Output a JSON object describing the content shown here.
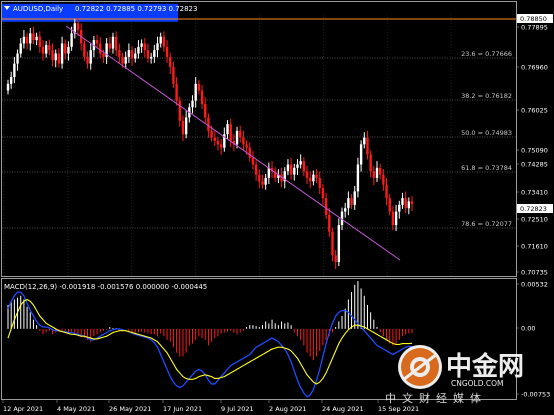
{
  "header": {
    "symbol": "AUDUSD,Daily",
    "ohlc": "0.72822 0.72885 0.72793 0.72823"
  },
  "macd": {
    "header": "MACD(12,26,9) -0.001918 -0.001576 0.000000 -0.000445"
  },
  "chart_data": [
    {
      "type": "candlestick",
      "title": "AUDUSD,Daily",
      "y_ticks": [
        "0.77895",
        "0.76960",
        "0.76025",
        "0.75090",
        "0.74285",
        "0.73410",
        "0.72510",
        "0.71610",
        "0.70735"
      ],
      "ylim": [
        0.7068,
        0.78
      ],
      "x_ticks": [
        "12 Apr 2021",
        "4 May 2021",
        "26 May 2021",
        "17 Jun 2021",
        "9 Jul 2021",
        "2 Aug 2021",
        "24 Aug 2021",
        "15 Sep 2021"
      ],
      "price_labels": {
        "high_line": "0.78850",
        "current": "0.72823"
      },
      "fibonacci": [
        {
          "label": "23.6 = 0.77666",
          "value": 0.77666
        },
        {
          "label": "38.2 = 0.76182",
          "value": 0.76182
        },
        {
          "label": "50.0 = 0.74983",
          "value": 0.74983
        },
        {
          "label": "61.8 = 0.73784",
          "value": 0.73784
        },
        {
          "label": "78.6 = 0.72077",
          "value": 0.72077
        }
      ],
      "high_level": 0.7785,
      "highlight_zone": [
        0.7768,
        0.7795
      ],
      "trendline": [
        [
          4,
          0.7835
        ],
        [
          135,
          0.712
        ]
      ],
      "close": [
        0.764,
        0.766,
        0.77,
        0.773,
        0.776,
        0.778,
        0.776,
        0.779,
        0.777,
        0.778,
        0.775,
        0.773,
        0.7755,
        0.774,
        0.771,
        0.773,
        0.77,
        0.776,
        0.773,
        0.775,
        0.779,
        0.782,
        0.78,
        0.776,
        0.772,
        0.77,
        0.774,
        0.777,
        0.776,
        0.773,
        0.772,
        0.776,
        0.7745,
        0.778,
        0.774,
        0.772,
        0.77,
        0.772,
        0.774,
        0.7715,
        0.773,
        0.775,
        0.776,
        0.774,
        0.7715,
        0.772,
        0.774,
        0.776,
        0.778,
        0.775,
        0.772,
        0.769,
        0.764,
        0.759,
        0.753,
        0.749,
        0.754,
        0.757,
        0.759,
        0.764,
        0.762,
        0.758,
        0.754,
        0.75,
        0.748,
        0.747,
        0.746,
        0.745,
        0.749,
        0.752,
        0.747,
        0.746,
        0.75,
        0.748,
        0.746,
        0.745,
        0.742,
        0.74,
        0.737,
        0.735,
        0.734,
        0.736,
        0.739,
        0.738,
        0.736,
        0.737,
        0.735,
        0.738,
        0.74,
        0.737,
        0.739,
        0.74,
        0.741,
        0.738,
        0.736,
        0.735,
        0.737,
        0.736,
        0.733,
        0.73,
        0.725,
        0.72,
        0.713,
        0.711,
        0.722,
        0.726,
        0.727,
        0.73,
        0.728,
        0.732,
        0.74,
        0.746,
        0.748,
        0.743,
        0.738,
        0.736,
        0.739,
        0.737,
        0.734,
        0.73,
        0.726,
        0.722,
        0.726,
        0.728,
        0.73,
        0.727,
        0.729,
        0.72823
      ],
      "macd_axis": [
        "0.00532",
        "0.00",
        "-0.00753"
      ],
      "macd_ylim": [
        -0.00753,
        0.00532
      ],
      "macd_hist": [
        0.0026,
        0.003,
        0.0032,
        0.0034,
        0.0036,
        0.0032,
        0.0024,
        0.0018,
        0.001,
        0.0004,
        -0.0002,
        -0.0006,
        -0.0004,
        -0.0002,
        -0.0006,
        -0.0004,
        -0.0002,
        -0.0003,
        -0.0002,
        -0.0004,
        -0.0003,
        -0.0006,
        -0.0007,
        -0.0009,
        -0.001,
        -0.0012,
        -0.0014,
        -0.0008,
        -0.0006,
        -0.0004,
        -0.0002,
        -0.0001,
        0.0002,
        0.0001,
        0.0001,
        -0.0002,
        -0.0001,
        0.0,
        -0.0003,
        -0.0005,
        -0.0004,
        -0.0004,
        -0.0003,
        -0.0004,
        -0.0005,
        -0.0006,
        -0.0006,
        -0.0008,
        -0.0005,
        -0.0008,
        -0.0012,
        -0.0014,
        -0.002,
        -0.0026,
        -0.003,
        -0.003,
        -0.0026,
        -0.0018,
        -0.0016,
        -0.0012,
        -0.0008,
        -0.001,
        -0.0012,
        -0.0018,
        -0.0014,
        -0.001,
        -0.0008,
        -0.0005,
        -0.0004,
        -0.0003,
        -0.0002,
        -0.0004,
        -0.0006,
        -0.0004,
        -0.0002,
        0.0002,
        0.0004,
        0.0004,
        0.0003,
        0.0002,
        0.0004,
        0.0008,
        0.0006,
        0.001,
        0.0006,
        0.0004,
        0.0008,
        0.0006,
        0.0007,
        0.0004,
        -0.0004,
        -0.0008,
        -0.0012,
        -0.0018,
        -0.0026,
        -0.003,
        -0.0034,
        -0.003,
        -0.0024,
        -0.0018,
        -0.0012,
        -0.0008,
        -0.0004,
        0.0002,
        0.0008,
        0.0014,
        0.0022,
        0.0032,
        0.004,
        0.0048,
        0.0052,
        0.0044,
        0.0036,
        0.0026,
        0.0018,
        0.001,
        0.0002,
        -0.0004,
        -0.0008,
        -0.0012,
        -0.0016,
        -0.0018,
        -0.0016,
        -0.0012,
        -0.0008,
        -0.0006,
        -0.0005,
        -0.000445
      ],
      "macd_line": [
        0.0022,
        0.003,
        0.0036,
        0.004,
        0.004,
        0.0036,
        0.0028,
        0.002,
        0.0014,
        0.0008,
        0.0004,
        0.0002,
        0.0002,
        0.0001,
        -0.0001,
        -0.0002,
        -0.0002,
        -0.0003,
        -0.0003,
        -0.0004,
        -0.0004,
        -0.0005,
        -0.0006,
        -0.0007,
        -0.0008,
        -0.001,
        -0.0012,
        -0.0012,
        -0.001,
        -0.0008,
        -0.0006,
        -0.0004,
        -0.0002,
        -0.0001,
        0.0,
        0.0,
        -0.0001,
        -0.0002,
        -0.0003,
        -0.0005,
        -0.0006,
        -0.0007,
        -0.0008,
        -0.0009,
        -0.001,
        -0.0012,
        -0.0015,
        -0.002,
        -0.0028,
        -0.0036,
        -0.0044,
        -0.0052,
        -0.0058,
        -0.0062,
        -0.0064,
        -0.0062,
        -0.0058,
        -0.0054,
        -0.005,
        -0.0046,
        -0.0044,
        -0.0046,
        -0.005,
        -0.0056,
        -0.006,
        -0.006,
        -0.0056,
        -0.0052,
        -0.0048,
        -0.0044,
        -0.004,
        -0.0038,
        -0.0036,
        -0.0034,
        -0.0032,
        -0.003,
        -0.0028,
        -0.0024,
        -0.002,
        -0.0018,
        -0.0016,
        -0.0014,
        -0.0012,
        -0.001,
        -0.0012,
        -0.0014,
        -0.0018,
        -0.0022,
        -0.0028,
        -0.0036,
        -0.0046,
        -0.0056,
        -0.0064,
        -0.007,
        -0.0074,
        -0.0072,
        -0.0066,
        -0.0056,
        -0.0044,
        -0.003,
        -0.0016,
        -0.0004,
        0.0006,
        0.0014,
        0.0018,
        0.002,
        0.002,
        0.0018,
        0.0014,
        0.001,
        0.0006,
        0.0002,
        -0.0002,
        -0.0006,
        -0.001,
        -0.0014,
        -0.0018,
        -0.002,
        -0.0022,
        -0.0024,
        -0.0026,
        -0.0028,
        -0.0026,
        -0.0024,
        -0.0022,
        -0.002,
        -0.0019,
        -0.001918
      ],
      "macd_signal": [
        -0.001,
        0.0,
        0.001,
        0.0018,
        0.0026,
        0.003,
        0.0032,
        0.003,
        0.0026,
        0.002,
        0.0014,
        0.001,
        0.0006,
        0.0004,
        0.0002,
        0.0,
        -0.0002,
        -0.0003,
        -0.0004,
        -0.0005,
        -0.0006,
        -0.0006,
        -0.0007,
        -0.0008,
        -0.0008,
        -0.0009,
        -0.001,
        -0.0011,
        -0.0011,
        -0.001,
        -0.0009,
        -0.0008,
        -0.0006,
        -0.0004,
        -0.0003,
        -0.0002,
        -0.0002,
        -0.0002,
        -0.0003,
        -0.0004,
        -0.0005,
        -0.0006,
        -0.0007,
        -0.0008,
        -0.0009,
        -0.001,
        -0.0012,
        -0.0014,
        -0.0018,
        -0.0022,
        -0.0026,
        -0.0032,
        -0.0038,
        -0.0044,
        -0.0048,
        -0.0052,
        -0.0054,
        -0.0055,
        -0.0055,
        -0.0054,
        -0.0052,
        -0.0051,
        -0.005,
        -0.0051,
        -0.0052,
        -0.0054,
        -0.0054,
        -0.0053,
        -0.0052,
        -0.005,
        -0.0048,
        -0.0046,
        -0.0044,
        -0.0042,
        -0.004,
        -0.0038,
        -0.0036,
        -0.0034,
        -0.0032,
        -0.003,
        -0.0028,
        -0.0026,
        -0.0024,
        -0.0022,
        -0.0021,
        -0.002,
        -0.002,
        -0.0021,
        -0.0022,
        -0.0024,
        -0.0028,
        -0.0032,
        -0.0038,
        -0.0044,
        -0.005,
        -0.0054,
        -0.0058,
        -0.006,
        -0.0058,
        -0.0054,
        -0.0048,
        -0.004,
        -0.0032,
        -0.0024,
        -0.0016,
        -0.001,
        -0.0005,
        -0.0001,
        0.0002,
        0.0004,
        0.0004,
        0.0003,
        0.0002,
        0.0,
        -0.0002,
        -0.0004,
        -0.0006,
        -0.0008,
        -0.001,
        -0.0012,
        -0.0014,
        -0.0016,
        -0.0017,
        -0.0017,
        -0.0016,
        -0.0016,
        -0.0016,
        -0.001576
      ],
      "colors": {
        "up": "#ffffff",
        "down": "#ff1a1a",
        "highlight": "#0a3cff",
        "high_line": "#ff8c1a",
        "trendline": "#c455d6",
        "macd_line": "#1e4bff",
        "signal_line": "#ffff1a",
        "hist_pos": "#ffffff",
        "hist_neg": "#ff1a1a",
        "fibo_line": "#9a9a9a",
        "grid": "#3c3c3c"
      }
    }
  ],
  "watermark": {
    "brand": "中金网",
    "domain": "CNGOLD.COM",
    "sub": "中文财经媒体"
  }
}
